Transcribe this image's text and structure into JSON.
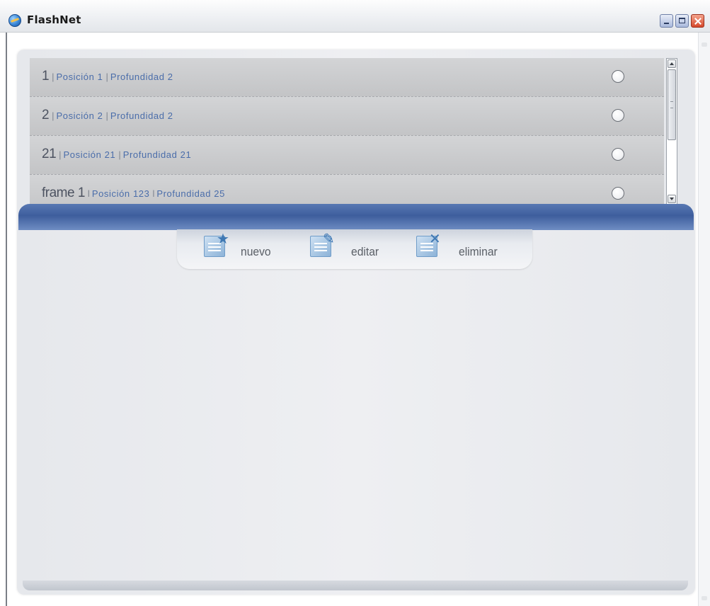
{
  "window": {
    "title": "FlashNet"
  },
  "list": {
    "rows": [
      {
        "id": "1",
        "sep1": "|",
        "position": "Posición 1",
        "sep2": "|",
        "depth": "Profundidad  2",
        "selected": false
      },
      {
        "id": "2",
        "sep1": "|",
        "position": "Posición 2",
        "sep2": "|",
        "depth": "Profundidad  2",
        "selected": false
      },
      {
        "id": "21",
        "sep1": "|",
        "position": "Posición 21",
        "sep2": "|",
        "depth": "Profundidad  21",
        "selected": false
      },
      {
        "id": "frame 1",
        "sep1": "l",
        "position": "Posición 123",
        "sep2": "l",
        "depth": "Profundidad  25",
        "selected": false
      }
    ]
  },
  "toolbar": {
    "new_label": "nuevo",
    "edit_label": "editar",
    "delete_label": "eliminar"
  },
  "icons": {
    "new": "new-document-icon",
    "edit": "edit-document-icon",
    "delete": "delete-document-icon"
  },
  "colors": {
    "band": "#3e5e9d",
    "meta_text": "#4a6daa",
    "panel": "#e8eaee"
  }
}
